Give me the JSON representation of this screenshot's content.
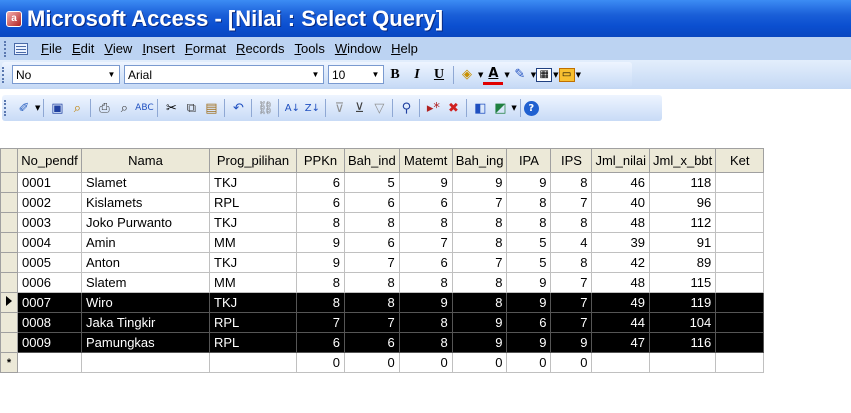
{
  "window": {
    "title": "Microsoft Access - [Nilai : Select Query]"
  },
  "menu": [
    "File",
    "Edit",
    "View",
    "Insert",
    "Format",
    "Records",
    "Tools",
    "Window",
    "Help"
  ],
  "format_toolbar": {
    "object_combo": "No",
    "font_combo": "Arial",
    "size_combo": "10",
    "bold": "B",
    "italic": "I",
    "underline": "U"
  },
  "datasheet": {
    "columns": [
      "No_pendf",
      "Nama",
      "Prog_pilihan",
      "PPKn",
      "Bah_ind",
      "Matemt",
      "Bah_ing",
      "IPA",
      "IPS",
      "Jml_nilai",
      "Jml_x_bbt",
      "Ket"
    ],
    "rows": [
      [
        "0001",
        "Slamet",
        "TKJ",
        "6",
        "5",
        "9",
        "9",
        "9",
        "8",
        "46",
        "118",
        ""
      ],
      [
        "0002",
        "Kislamets",
        "RPL",
        "6",
        "6",
        "6",
        "7",
        "8",
        "7",
        "40",
        "96",
        ""
      ],
      [
        "0003",
        "Joko Purwanto",
        "TKJ",
        "8",
        "8",
        "8",
        "8",
        "8",
        "8",
        "48",
        "112",
        ""
      ],
      [
        "0004",
        "Amin",
        "MM",
        "9",
        "6",
        "7",
        "8",
        "5",
        "4",
        "39",
        "91",
        ""
      ],
      [
        "0005",
        "Anton",
        "TKJ",
        "9",
        "7",
        "6",
        "7",
        "5",
        "8",
        "42",
        "89",
        ""
      ],
      [
        "0006",
        "Slatem",
        "MM",
        "8",
        "8",
        "8",
        "8",
        "9",
        "7",
        "48",
        "115",
        ""
      ],
      [
        "0007",
        "Wiro",
        "TKJ",
        "8",
        "8",
        "9",
        "8",
        "9",
        "7",
        "49",
        "119",
        ""
      ],
      [
        "0008",
        "Jaka Tingkir",
        "RPL",
        "7",
        "7",
        "8",
        "9",
        "6",
        "7",
        "44",
        "104",
        ""
      ],
      [
        "0009",
        "Pamungkas",
        "RPL",
        "6",
        "6",
        "8",
        "9",
        "9",
        "9",
        "47",
        "116",
        ""
      ]
    ],
    "highlighted_rows": [
      6,
      7,
      8
    ],
    "current_row": 6,
    "new_row": [
      "",
      "",
      "",
      "0",
      "0",
      "0",
      "0",
      "0",
      "0",
      "",
      "",
      ""
    ],
    "new_row_marker": "*"
  }
}
